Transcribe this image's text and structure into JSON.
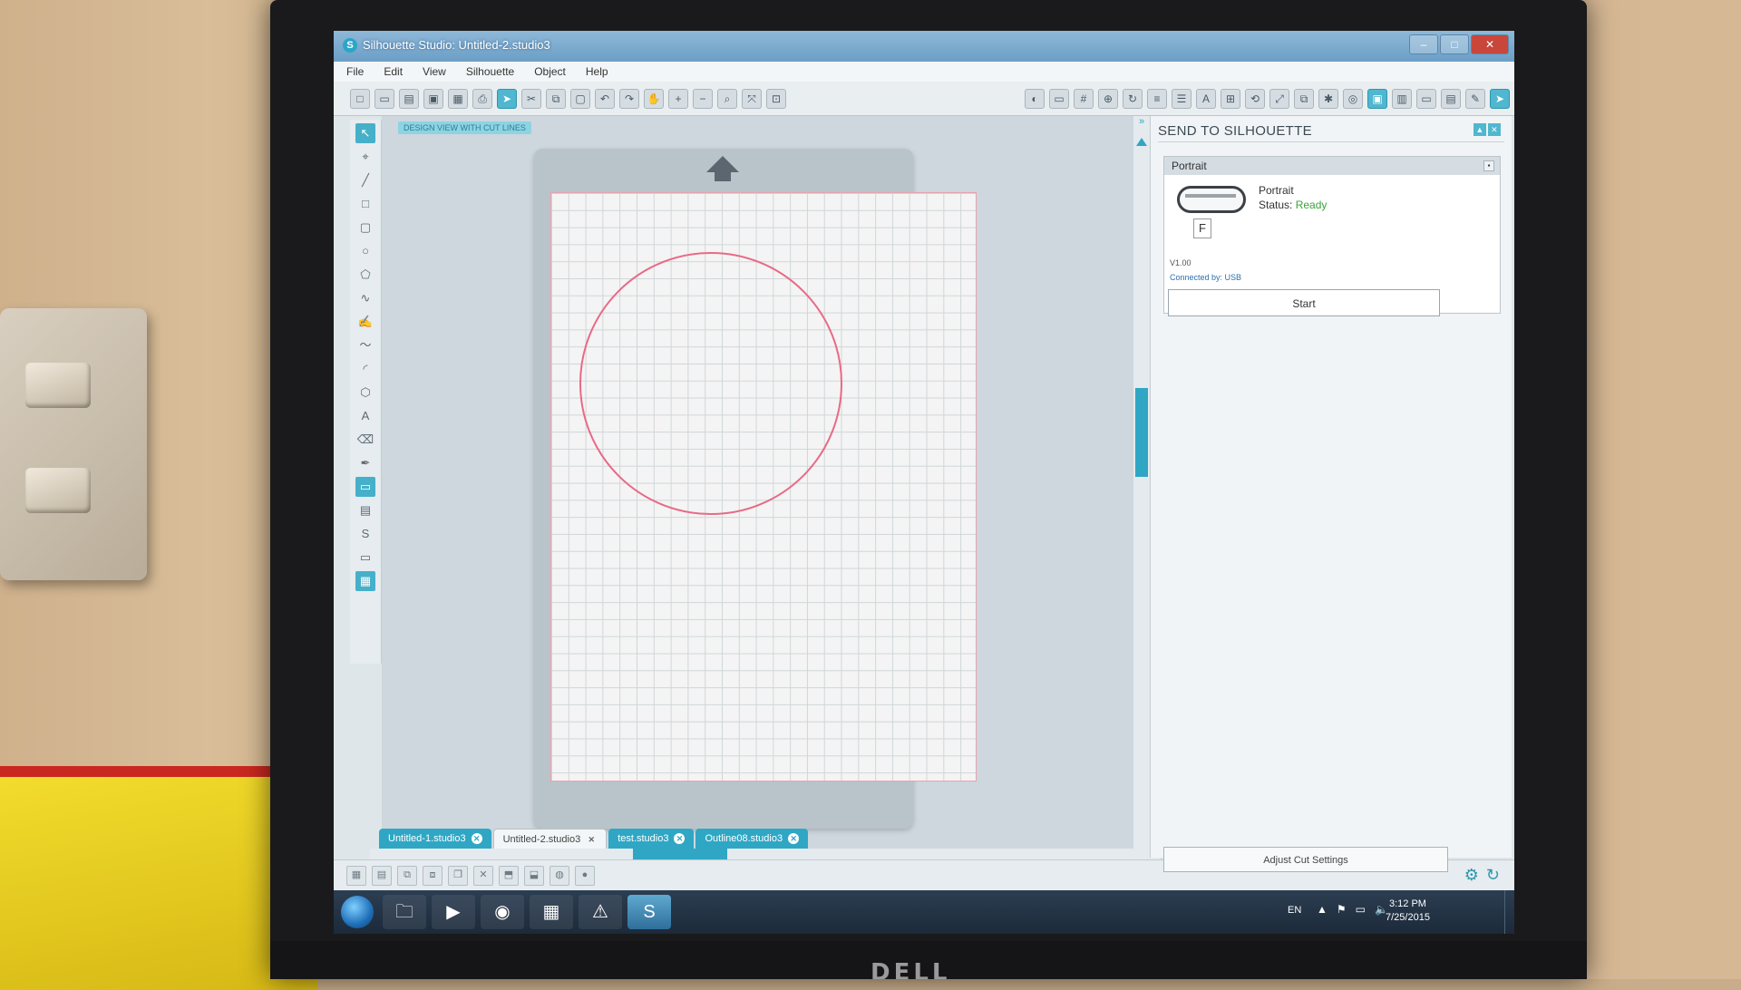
{
  "window": {
    "title": "Silhouette Studio: Untitled-2.studio3"
  },
  "menu": [
    "File",
    "Edit",
    "View",
    "Silhouette",
    "Object",
    "Help"
  ],
  "canvas": {
    "view_mode_label": "DESIGN VIEW WITH CUT LINES"
  },
  "doc_tabs": [
    {
      "label": "Untitled-1.studio3",
      "active": false
    },
    {
      "label": "Untitled-2.studio3",
      "active": true
    },
    {
      "label": "test.studio3",
      "active": false
    },
    {
      "label": "Outline08.studio3",
      "active": false
    }
  ],
  "send_panel": {
    "title": "SEND TO SILHOUETTE",
    "device_card_title": "Portrait",
    "device_name": "Portrait",
    "status_label": "Status:",
    "status_value": "Ready",
    "status_color": "#3aa33a",
    "firmware": "V1.00",
    "connection": "Connected by: USB",
    "start_label": "Start",
    "adjust_label": "Adjust Cut Settings"
  },
  "taskbar": {
    "language": "EN",
    "time": "3:12 PM",
    "date": "7/25/2015",
    "apps": [
      "explorer-icon",
      "media-player-icon",
      "chrome-icon",
      "app-icon",
      "warning-icon",
      "silhouette-icon"
    ]
  },
  "monitor": {
    "brand": "DELL"
  },
  "colors": {
    "accent": "#2fa7c4",
    "cut_line": "#e86a86"
  }
}
